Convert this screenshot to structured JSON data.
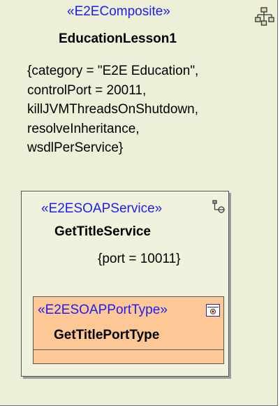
{
  "composite": {
    "stereotype": "«E2EComposite»",
    "name": "EducationLesson1",
    "properties": [
      "{category = \"E2E Education\",",
      "controlPort = 20011,",
      "killJVMThreadsOnShutdown,",
      "resolveInheritance,",
      "wsdlPerService}"
    ],
    "icon": "composite-structure-icon"
  },
  "service": {
    "stereotype": "«E2ESOAPService»",
    "name": "GetTitleService",
    "port": "{port = 10011}",
    "icon": "service-port-icon"
  },
  "port_type": {
    "stereotype": "«E2ESOAPPortType»",
    "name": "GetTitlePortType",
    "icon": "port-type-icon"
  },
  "colors": {
    "composite_fill": "#eeefd9",
    "service_fill": "#f1f2dd",
    "port_type_fill": "#fdc895",
    "stereotype_text": "#1c1cf0"
  }
}
